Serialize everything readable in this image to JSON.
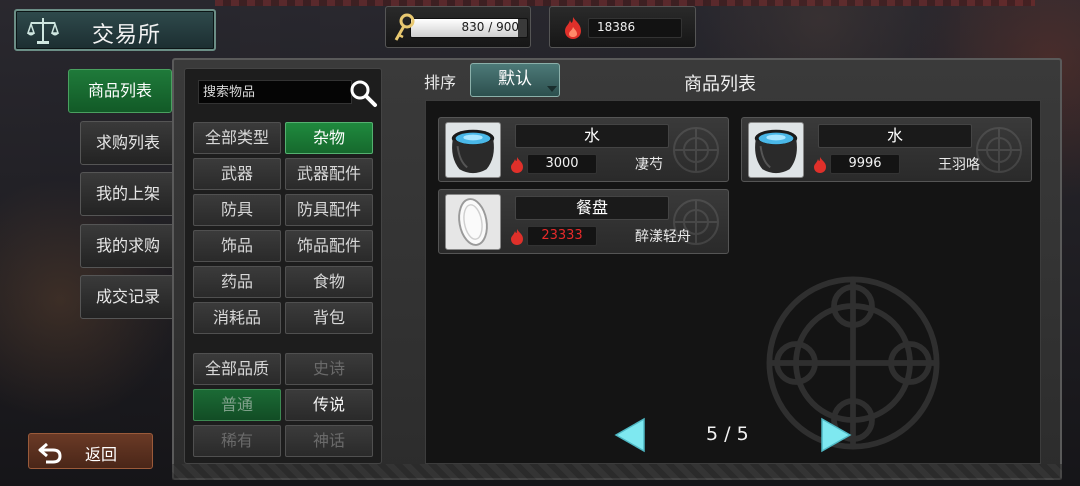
{
  "header": {
    "title": "交易所",
    "title_icon": "scales-icon"
  },
  "resources": {
    "stamina": {
      "icon": "key-icon",
      "text": "830 / 900",
      "current": 830,
      "max": 900
    },
    "currency": {
      "icon": "flame-icon",
      "text": "18386"
    }
  },
  "tabs": [
    {
      "label": "商品列表",
      "active": true
    },
    {
      "label": "求购列表",
      "active": false
    },
    {
      "label": "我的上架",
      "active": false
    },
    {
      "label": "我的求购",
      "active": false
    },
    {
      "label": "成交记录",
      "active": false
    }
  ],
  "search": {
    "placeholder": "搜索物品",
    "value": ""
  },
  "type_filters": [
    {
      "label": "全部类型"
    },
    {
      "label": "杂物",
      "active": true
    },
    {
      "label": "武器"
    },
    {
      "label": "武器配件"
    },
    {
      "label": "防具"
    },
    {
      "label": "防具配件"
    },
    {
      "label": "饰品"
    },
    {
      "label": "饰品配件"
    },
    {
      "label": "药品"
    },
    {
      "label": "食物"
    },
    {
      "label": "消耗品"
    },
    {
      "label": "背包"
    }
  ],
  "quality_filters": [
    {
      "label": "全部品质"
    },
    {
      "label": "史诗",
      "dim": true
    },
    {
      "label": "普通",
      "active": true
    },
    {
      "label": "传说"
    },
    {
      "label": "稀有",
      "dim": true
    },
    {
      "label": "神话",
      "dim": true
    }
  ],
  "sort": {
    "label": "排序",
    "value": "默认"
  },
  "list": {
    "title": "商品列表",
    "items": [
      {
        "name": "水",
        "price": "3000",
        "seller": "凄芍",
        "icon": "water-pot-icon",
        "price_color": "#f2f2f2"
      },
      {
        "name": "水",
        "price": "9996",
        "seller": "王羽咯",
        "icon": "water-pot-icon",
        "price_color": "#f2f2f2"
      },
      {
        "name": "餐盘",
        "price": "23333",
        "seller": "醉漾轻舟",
        "icon": "plate-icon",
        "price_color": "#e82a2a"
      }
    ]
  },
  "pager": {
    "text": "5 / 5",
    "current": 5,
    "total": 5
  },
  "back": {
    "label": "返回"
  },
  "colors": {
    "accent_green": "#1f8a3e",
    "teal": "#4d7a78",
    "price_red": "#e82a2a",
    "arrow_cyan": "#7ee8f0"
  }
}
